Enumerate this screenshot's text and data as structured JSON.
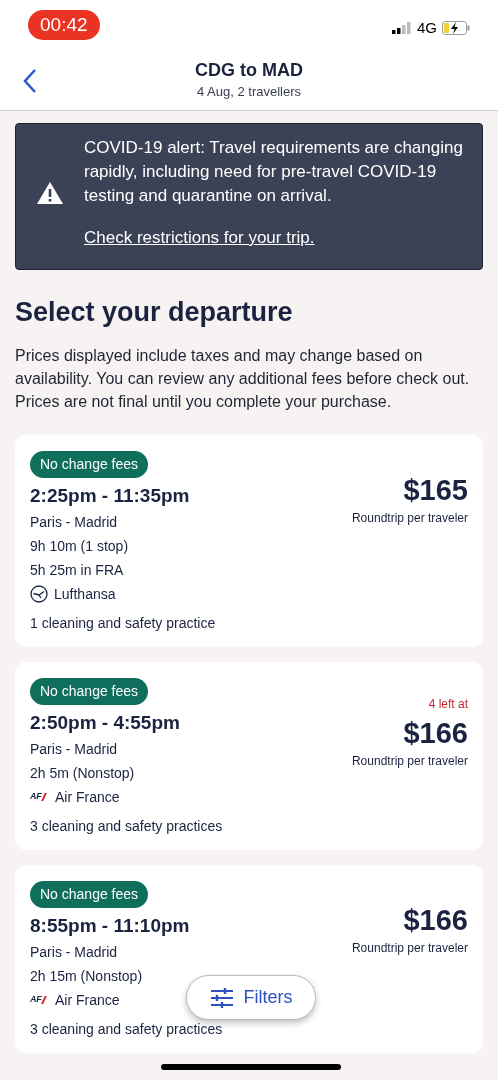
{
  "status_bar": {
    "time": "00:42",
    "network": "4G"
  },
  "header": {
    "title": "CDG to MAD",
    "subtitle": "4 Aug, 2 travellers"
  },
  "alert": {
    "message": "COVID-19 alert: Travel requirements are changing rapidly, including need for pre-travel COVID-19 testing and quarantine on arrival.",
    "link": "Check restrictions for your trip."
  },
  "heading": "Select your departure",
  "disclaimer": "Prices displayed include taxes and may change based on availability. You can review any additional fees before check out. Prices are not final until you complete your purchase.",
  "flights": [
    {
      "badge": "No change fees",
      "times": "2:25pm - 11:35pm",
      "route": "Paris - Madrid",
      "duration": "9h 10m (1 stop)",
      "layover": "5h 25m in FRA",
      "airline": {
        "kind": "crane",
        "name": "Lufthansa"
      },
      "practices": "1 cleaning and safety practice",
      "price": "$165",
      "price_note": "Roundtrip per traveler"
    },
    {
      "badge": "No change fees",
      "times": "2:50pm - 4:55pm",
      "route": "Paris - Madrid",
      "duration": "2h 5m (Nonstop)",
      "airline": {
        "kind": "letters",
        "logo": "AF",
        "name": "Air France"
      },
      "practices": "3 cleaning and safety practices",
      "seats_left": "4 left at",
      "price": "$166",
      "price_note": "Roundtrip per traveler"
    },
    {
      "badge": "No change fees",
      "times": "8:55pm - 11:10pm",
      "route": "Paris - Madrid",
      "duration": "2h 15m (Nonstop)",
      "airline": {
        "kind": "letters",
        "logo": "AF",
        "name": "Air France"
      },
      "practices": "3 cleaning and safety practices",
      "price": "$166",
      "price_note": "Roundtrip per traveler"
    }
  ],
  "filters_button": "Filters"
}
